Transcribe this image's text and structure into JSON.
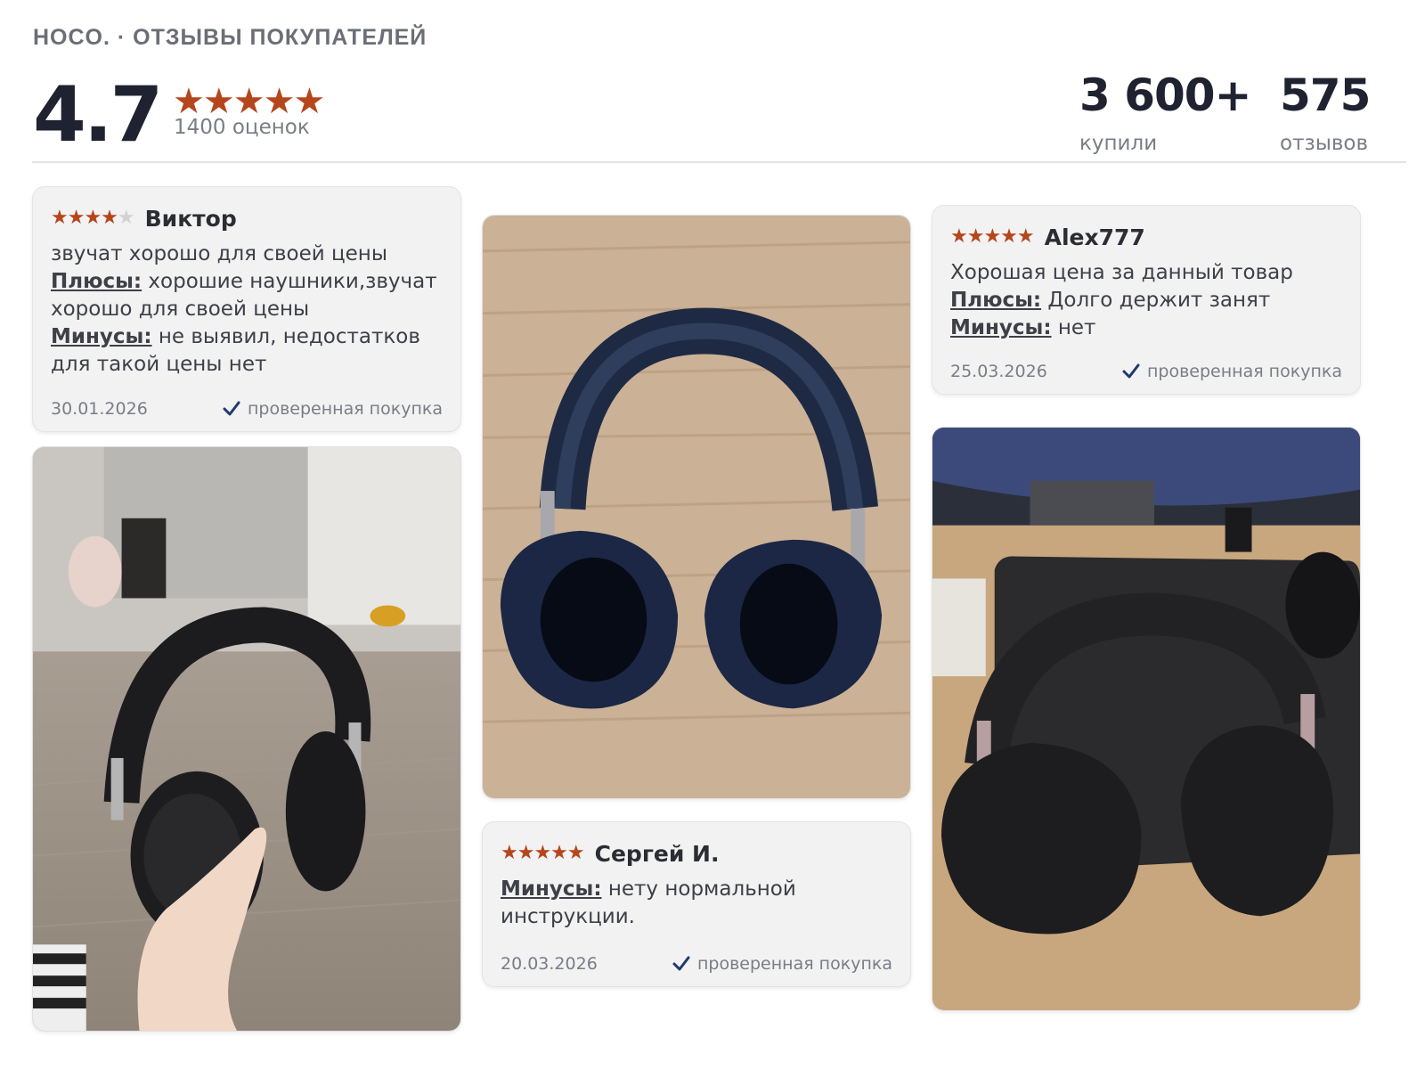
{
  "header": {
    "brand_line": "HOCO. · ОТЗЫВЫ ПОКУПАТЕЛЕЙ",
    "rating": "4.7",
    "stars": 4.7,
    "rating_count": "1400 оценок",
    "stats": [
      {
        "value": "3 600+",
        "label": "купили"
      },
      {
        "value": "575",
        "label": "отзывов"
      }
    ]
  },
  "reviews": [
    {
      "author": "Виктор",
      "stars": 4,
      "text": "звучат хорошо для своей цены",
      "pros_label": "Плюсы:",
      "pros": "хорошие наушники,звучат хорошо для своей цены",
      "cons_label": "Минусы:",
      "cons": "не выявил, недостатков для такой цены нет",
      "date": "30.01.2026",
      "verified": "проверенная покупка"
    },
    {
      "author": "Alex777",
      "stars": 5,
      "text": "Хорошая цена за данный товар",
      "pros_label": "Плюсы:",
      "pros": "Долго держит занят",
      "cons_label": "Минусы:",
      "cons": "нет",
      "date": "25.03.2026",
      "verified": "проверенная покупка"
    },
    {
      "author": "Сергей И.",
      "stars": 5,
      "cons_label": "Минусы:",
      "cons": "нету нормальной инструкции.",
      "date": "20.03.2026",
      "verified": "проверенная покупка"
    }
  ],
  "colors": {
    "star": "#b5461c",
    "star_off": "#d3d3d5",
    "card_bg": "#f2f2f3",
    "check": "#1f3a6e"
  }
}
